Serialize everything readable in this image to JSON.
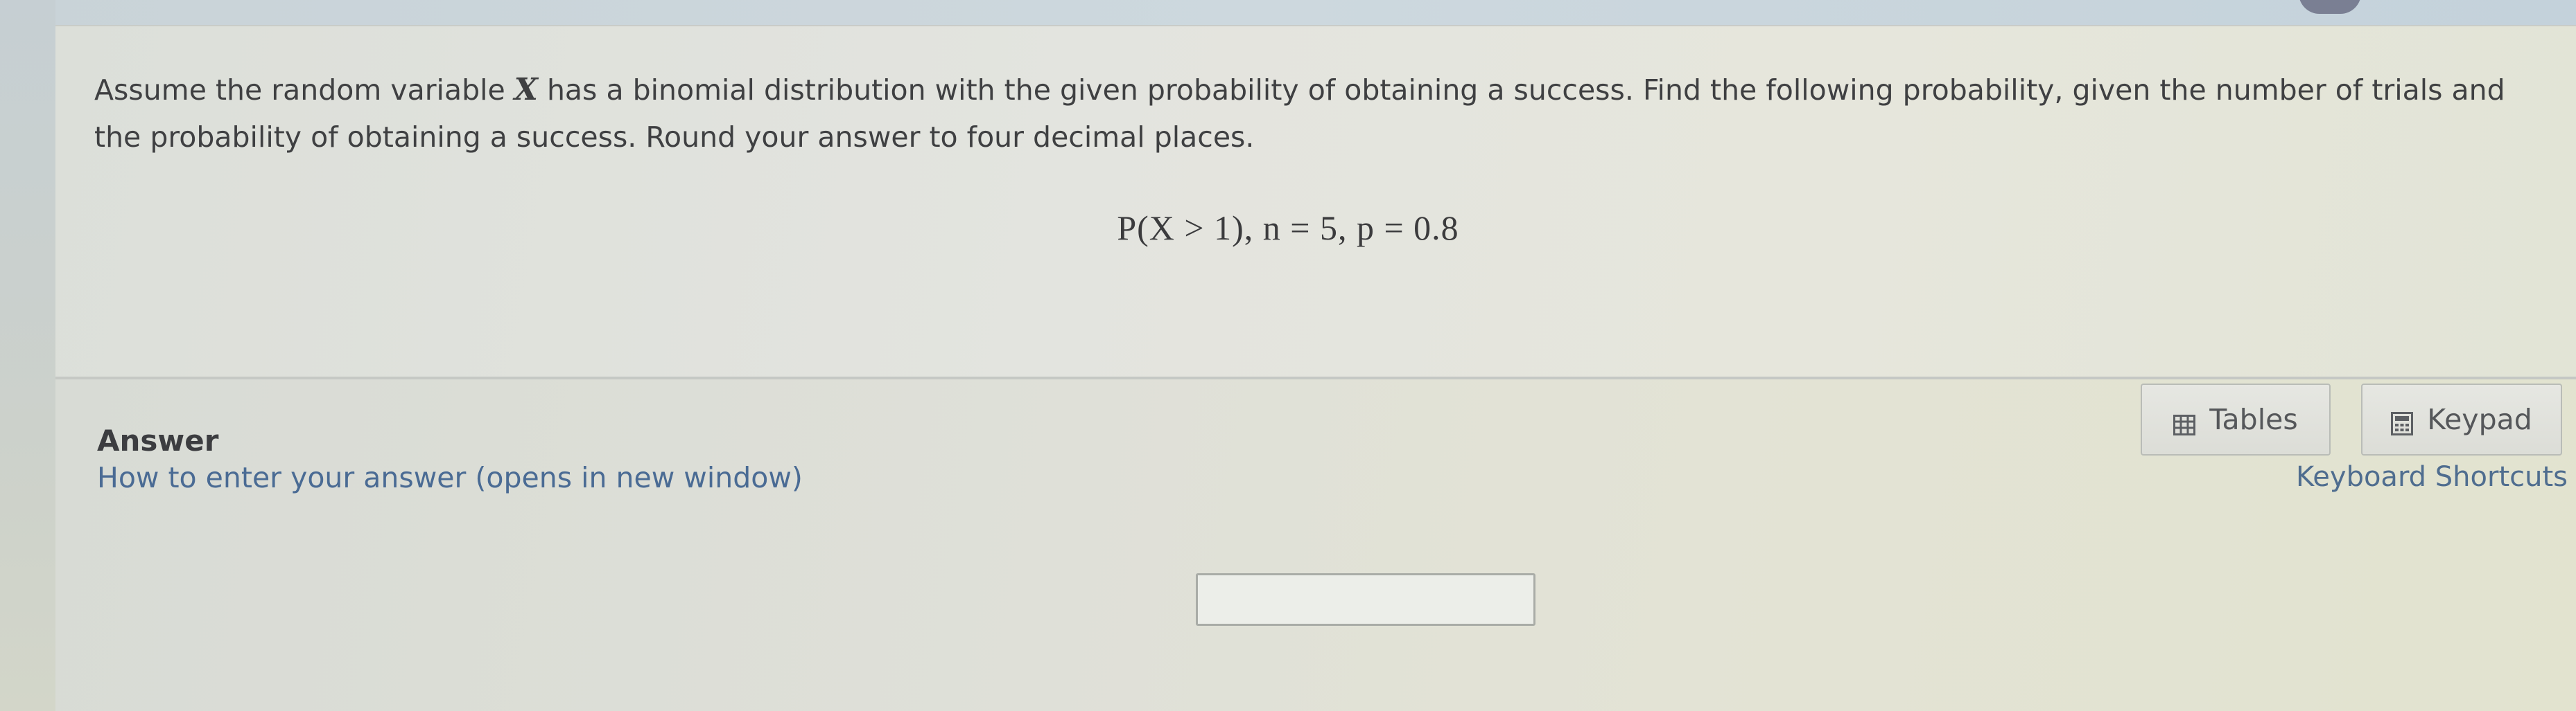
{
  "question": {
    "text_before_var": "Assume the random variable ",
    "variable": "X",
    "text_after_var": " has a binomial distribution with the given probability of obtaining a success. Find the following probability, given the number of trials and the probability of obtaining a success. Round your answer to four decimal places.",
    "formula": "P(X > 1), n = 5, p = 0.8"
  },
  "answer": {
    "label": "Answer",
    "help_link": "How to enter your answer (opens in new window)",
    "input_value": "",
    "input_placeholder": ""
  },
  "tools": {
    "tables_label": "Tables",
    "tables_icon": "table-icon",
    "keypad_label": "Keypad",
    "keypad_icon": "calculator-icon",
    "shortcuts_label": "Keyboard Shortcuts"
  },
  "colors": {
    "link": "#4a6b94",
    "text": "#3f4042"
  }
}
